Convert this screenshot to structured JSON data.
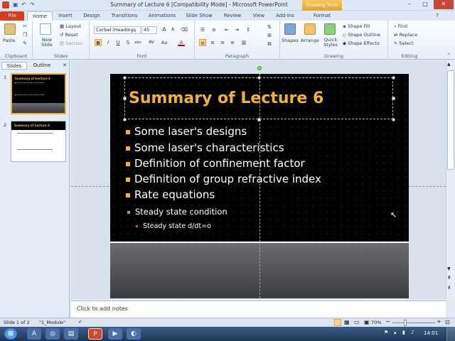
{
  "window": {
    "title": "Summary of Lecture 6 [Compatibility Mode] - Microsoft PowerPoint",
    "context_tab": "Drawing Tools",
    "minimize": "–",
    "maximize": "□",
    "close": "✕"
  },
  "tabs": [
    "File",
    "Home",
    "Insert",
    "Design",
    "Transitions",
    "Animations",
    "Slide Show",
    "Review",
    "View",
    "Add-Ins",
    "Format"
  ],
  "ribbon": {
    "clipboard": {
      "label": "Clipboard",
      "paste": "Paste"
    },
    "slides": {
      "label": "Slides",
      "new_slide": "New Slide",
      "layout": "Layout",
      "reset": "Reset",
      "section": "Section"
    },
    "font": {
      "label": "Font",
      "family": "Corbel (Headings",
      "size": "45",
      "bold": "B",
      "italic": "I",
      "underline": "U",
      "strike": "S",
      "shadow": "abc",
      "spacing": "AV",
      "case": "Aa",
      "grow": "A",
      "shrink": "A"
    },
    "paragraph": {
      "label": "Paragraph"
    },
    "drawing": {
      "label": "Drawing",
      "shapes": "Shapes",
      "arrange": "Arrange",
      "quick_styles": "Quick Styles",
      "shape_fill": "Shape Fill",
      "shape_outline": "Shape Outline",
      "shape_effects": "Shape Effects"
    },
    "editing": {
      "label": "Editing",
      "find": "Find",
      "replace": "Replace",
      "select": "Select"
    }
  },
  "left_pane": {
    "tabs": [
      "Slides",
      "Outline"
    ],
    "slides": [
      {
        "num": "1",
        "title": "Summary of Lecture 6"
      },
      {
        "num": "2",
        "title": "Summary of Lecture 6"
      }
    ]
  },
  "slide": {
    "title": "Summary of Lecture 6",
    "bullets": [
      "Some laser's designs",
      "Some laser's characteristics",
      "Definition of confinement factor",
      "Definition of group refractive index",
      "Rate equations"
    ],
    "sub_bullet": "Steady state condition",
    "sub_sub_bullet": "Steady state d/dt=o"
  },
  "notes": {
    "placeholder": "Click to add notes"
  },
  "status": {
    "slide": "Slide 1 of 2",
    "theme": "\"1_Module\"",
    "zoom": "70%"
  },
  "taskbar": {
    "time": "14:01"
  },
  "colors": {
    "accent": "#f2b32d",
    "file_tab": "#d23d1f",
    "slide_bg": "#000000"
  }
}
